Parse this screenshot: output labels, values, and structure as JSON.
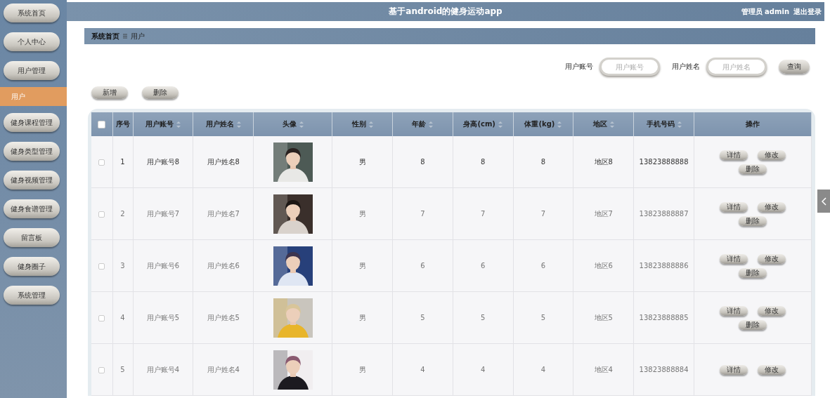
{
  "sidebar": {
    "items": [
      {
        "label": "系统首页",
        "selected": false
      },
      {
        "label": "个人中心",
        "selected": false
      },
      {
        "label": "用户管理",
        "selected": false,
        "children": [
          {
            "label": "用户",
            "selected": true
          }
        ]
      },
      {
        "label": "健身课程管理",
        "selected": false
      },
      {
        "label": "健身类型管理",
        "selected": false
      },
      {
        "label": "健身视频管理",
        "selected": false
      },
      {
        "label": "健身食谱管理",
        "selected": false
      },
      {
        "label": "留言板",
        "selected": false
      },
      {
        "label": "健身圈子",
        "selected": false
      },
      {
        "label": "系统管理",
        "selected": false
      }
    ]
  },
  "header": {
    "title": "基于android的健身运动app",
    "user": "管理员 admin",
    "logout": "退出登录"
  },
  "breadcrumb": [
    "系统首页",
    "用户"
  ],
  "search": {
    "fields": [
      {
        "label": "用户账号",
        "placeholder": "用户账号"
      },
      {
        "label": "用户姓名",
        "placeholder": "用户姓名"
      }
    ],
    "button": "查询"
  },
  "toolbar": [
    "新增",
    "删除"
  ],
  "table": {
    "select_all": {
      "checked": false
    },
    "columns": [
      {
        "label": "序号",
        "sortable": false
      },
      {
        "label": "用户账号",
        "sortable": true
      },
      {
        "label": "用户姓名",
        "sortable": true
      },
      {
        "label": "头像",
        "sortable": true
      },
      {
        "label": "性别",
        "sortable": true
      },
      {
        "label": "年龄",
        "sortable": true
      },
      {
        "label": "身高(cm)",
        "sortable": true
      },
      {
        "label": "体重(kg)",
        "sortable": true
      },
      {
        "label": "地区",
        "sortable": true
      },
      {
        "label": "手机号码",
        "sortable": true
      },
      {
        "label": "操作",
        "sortable": false
      }
    ],
    "rows": [
      {
        "checked": false,
        "cells": [
          "1",
          "用户账号8",
          "用户姓名8",
          {
            "kind": "picture"
          },
          "男",
          "8",
          "8",
          "8",
          "地区8",
          "13823888888"
        ],
        "actions": [
          "详情",
          "修改",
          "删除"
        ]
      },
      {
        "checked": false,
        "cells": [
          "2",
          "用户账号7",
          "用户姓名7",
          {
            "kind": "picture"
          },
          "男",
          "7",
          "7",
          "7",
          "地区7",
          "13823888887"
        ],
        "actions": [
          "详情",
          "修改",
          "删除"
        ]
      },
      {
        "checked": false,
        "cells": [
          "3",
          "用户账号6",
          "用户姓名6",
          {
            "kind": "picture"
          },
          "男",
          "6",
          "6",
          "6",
          "地区6",
          "13823888886"
        ],
        "actions": [
          "详情",
          "修改",
          "删除"
        ]
      },
      {
        "checked": false,
        "cells": [
          "4",
          "用户账号5",
          "用户姓名5",
          {
            "kind": "picture"
          },
          "男",
          "5",
          "5",
          "5",
          "地区5",
          "13823888885"
        ],
        "actions": [
          "详情",
          "修改",
          "删除"
        ]
      },
      {
        "checked": false,
        "cells": [
          "5",
          "用户账号4",
          "用户姓名4",
          {
            "kind": "picture"
          },
          "男",
          "4",
          "4",
          "4",
          "地区4",
          "13823888884"
        ],
        "actions": [
          "详情",
          "修改"
        ]
      }
    ]
  }
}
